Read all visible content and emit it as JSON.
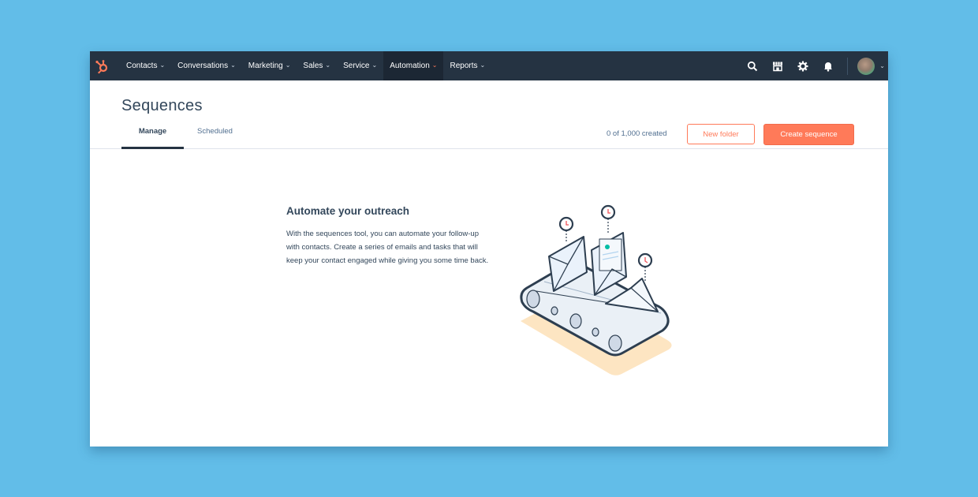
{
  "nav": {
    "logo": "hubspot-sprocket-icon",
    "items": [
      {
        "label": "Contacts",
        "active": false
      },
      {
        "label": "Conversations",
        "active": false
      },
      {
        "label": "Marketing",
        "active": false
      },
      {
        "label": "Sales",
        "active": false
      },
      {
        "label": "Service",
        "active": false
      },
      {
        "label": "Automation",
        "active": true
      },
      {
        "label": "Reports",
        "active": false
      }
    ],
    "chevron": "⌄",
    "right_icons": [
      "search-icon",
      "marketplace-icon",
      "settings-icon",
      "notifications-icon"
    ]
  },
  "header": {
    "title": "Sequences",
    "count_text": "0 of 1,000 created",
    "new_folder_label": "New folder",
    "create_label": "Create sequence",
    "tabs": [
      {
        "label": "Manage",
        "active": true
      },
      {
        "label": "Scheduled",
        "active": false
      }
    ]
  },
  "empty_state": {
    "title": "Automate your outreach",
    "description": "With the sequences tool, you can automate your follow-up with contacts. Create a series of emails and tasks that will keep your contact engaged while giving you some time back.",
    "illustration": "email-conveyor-belt-illustration"
  },
  "colors": {
    "background": "#62bde8",
    "nav_bg": "#253342",
    "accent": "#ff7a59",
    "text": "#33475b"
  }
}
